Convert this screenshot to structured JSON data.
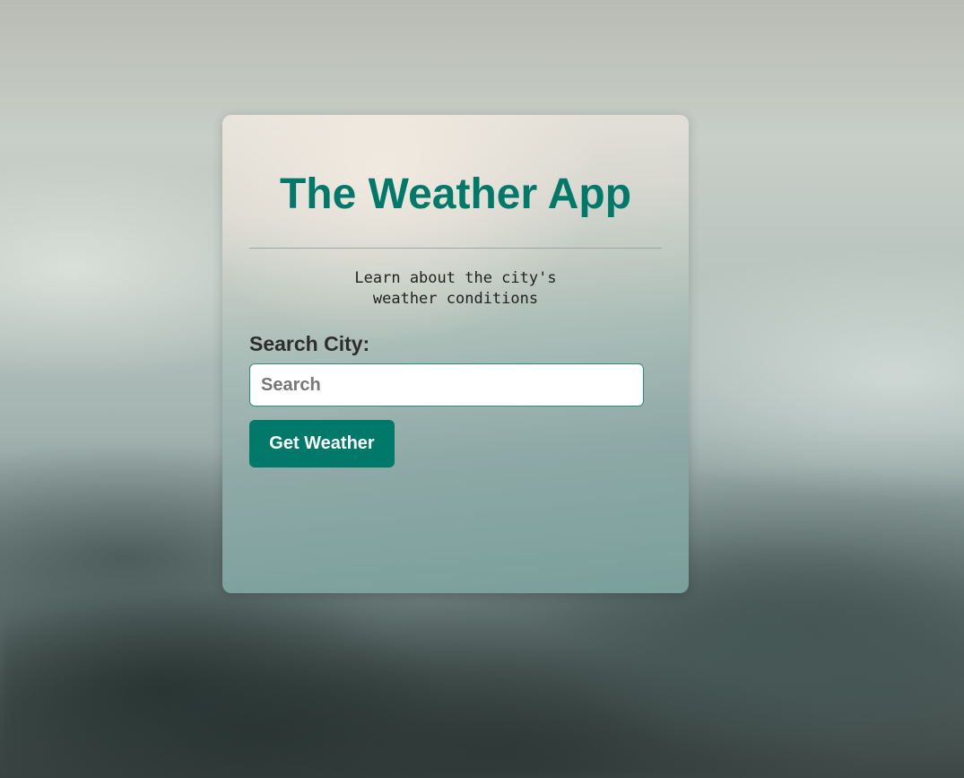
{
  "app": {
    "title": "The Weather App",
    "subtitle": "Learn about the city's\nweather conditions"
  },
  "search": {
    "label": "Search City:",
    "placeholder": "Search",
    "value": ""
  },
  "actions": {
    "get_weather_label": "Get Weather"
  },
  "colors": {
    "accent": "#00796b",
    "input_border": "#2e8b84"
  }
}
